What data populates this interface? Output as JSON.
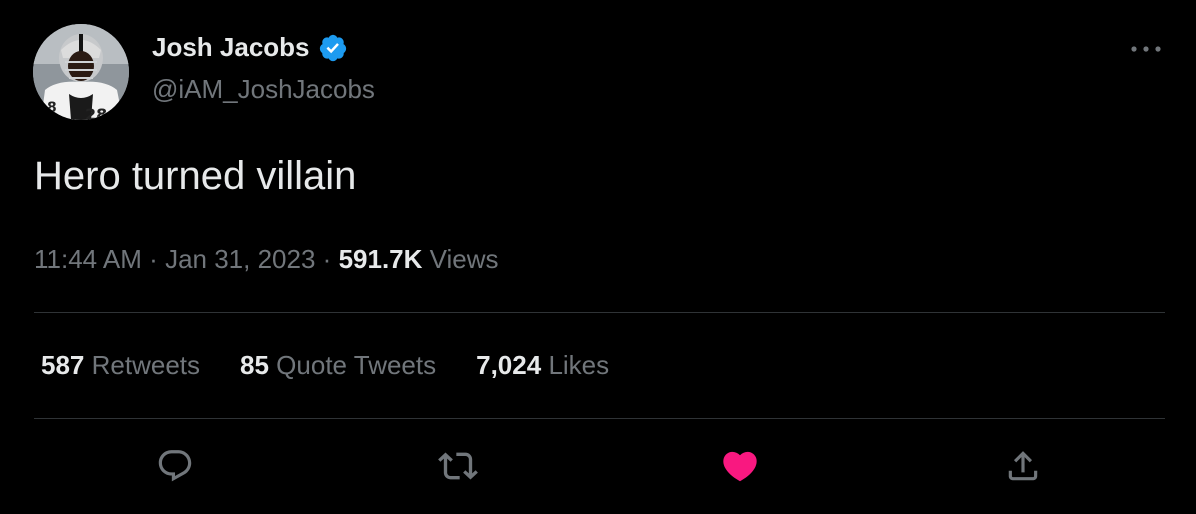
{
  "author": {
    "display_name": "Josh Jacobs",
    "handle": "@iAM_JoshJacobs",
    "verified_icon": "verified-badge-icon",
    "avatar_icon": "profile-photo"
  },
  "tweet": {
    "text": "Hero turned villain",
    "time": "11:44 AM",
    "separator": "·",
    "date": "Jan 31, 2023",
    "views_count": "591.7K",
    "views_label": "Views"
  },
  "stats": [
    {
      "count": "587",
      "label": "Retweets"
    },
    {
      "count": "85",
      "label": "Quote Tweets"
    },
    {
      "count": "7,024",
      "label": "Likes"
    }
  ],
  "actions": {
    "reply_icon": "reply-icon",
    "retweet_icon": "retweet-icon",
    "like_icon": "like-heart-icon",
    "share_icon": "share-icon",
    "more_icon": "more-options-icon"
  },
  "colors": {
    "background": "#000000",
    "primary_text": "#e7e9ea",
    "secondary_text": "#71767b",
    "divider": "#2f3336",
    "verified": "#1d9bf0",
    "like": "#f91880"
  }
}
